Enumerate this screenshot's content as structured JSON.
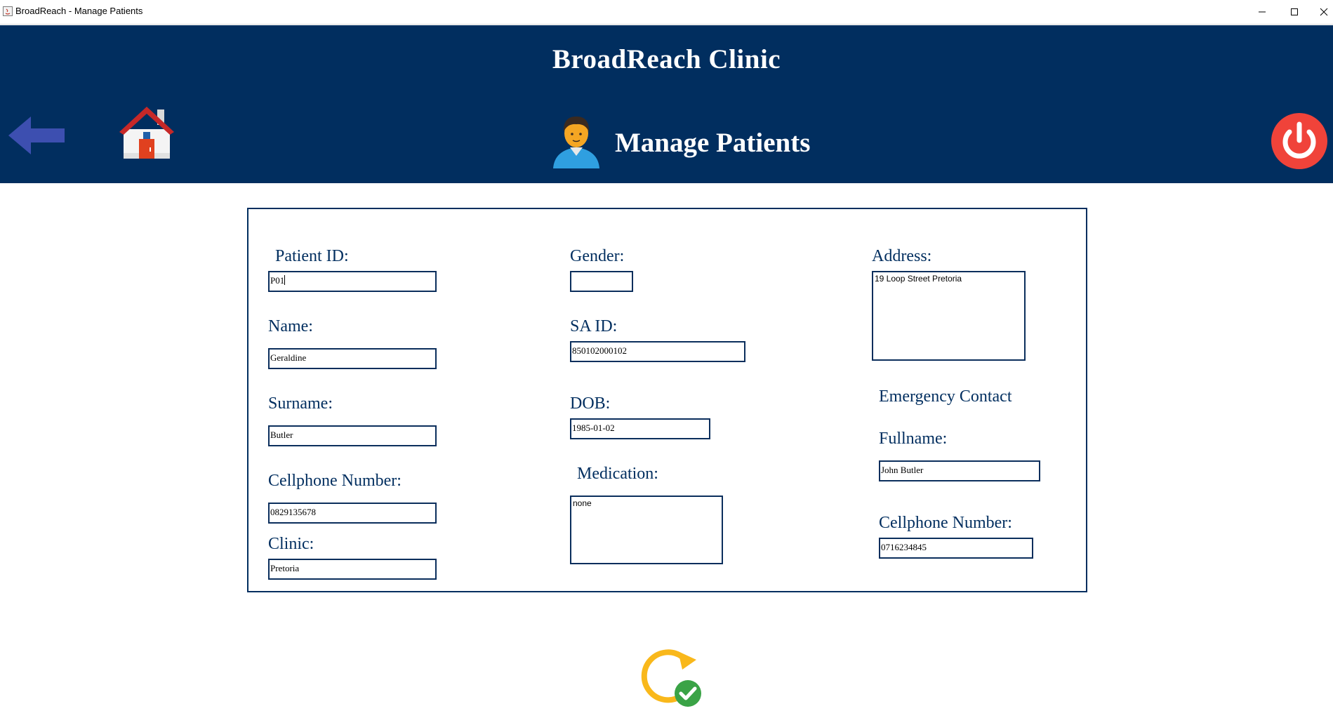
{
  "window": {
    "title": "BroadReach - Manage Patients"
  },
  "header": {
    "clinic_name": "BroadReach Clinic",
    "page_title": "Manage Patients"
  },
  "form": {
    "patient_id": {
      "label": "Patient ID:",
      "value": "P01"
    },
    "name": {
      "label": "Name:",
      "value": "Geraldine"
    },
    "surname": {
      "label": "Surname:",
      "value": "Butler"
    },
    "cellphone": {
      "label": "Cellphone Number:",
      "value": "0829135678"
    },
    "clinic": {
      "label": "Clinic:",
      "value": "Pretoria"
    },
    "gender": {
      "label": "Gender:",
      "value": ""
    },
    "sa_id": {
      "label": "SA ID:",
      "value": "850102000102"
    },
    "dob": {
      "label": "DOB:",
      "value": "1985-01-02"
    },
    "medication": {
      "label": "Medication:",
      "value": "none"
    },
    "address": {
      "label": "Address:",
      "value": "19 Loop Street Pretoria"
    },
    "emergency": {
      "heading": "Emergency Contact",
      "fullname": {
        "label": "Fullname:",
        "value": "John Butler"
      },
      "cellphone": {
        "label": "Cellphone Number:",
        "value": "0716234845"
      }
    }
  },
  "icons": {
    "back": "arrow-left-icon",
    "home": "home-icon",
    "patient": "patient-avatar-icon",
    "power": "power-icon",
    "save": "refresh-check-icon"
  },
  "colors": {
    "header_bg": "#012e5f",
    "label": "#012e5f",
    "power_red": "#f0433a",
    "back_arrow": "#3d4fb0",
    "save_yellow": "#f9b81b",
    "save_green": "#3aa346"
  }
}
